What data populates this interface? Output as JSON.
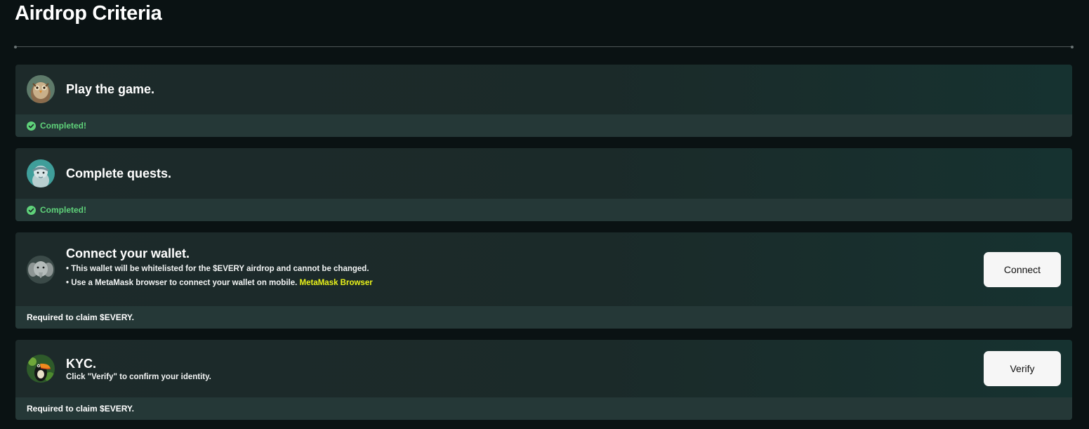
{
  "page": {
    "title": "Airdrop Criteria"
  },
  "colors": {
    "background": "#0a1213",
    "card": "#1d2a2a",
    "card_footer": "#253837",
    "completed_green": "#5fd27a",
    "link_yellow": "#e9f21a",
    "button_bg": "#f6f6f6"
  },
  "criteria": [
    {
      "avatar_icon": "owl-avatar-icon",
      "title": "Play the game.",
      "status": "Completed!",
      "status_icon": "check-circle-icon"
    },
    {
      "avatar_icon": "dolphin-avatar-icon",
      "title": "Complete quests.",
      "status": "Completed!",
      "status_icon": "check-circle-icon"
    },
    {
      "avatar_icon": "elephant-avatar-icon",
      "title": "Connect your wallet.",
      "desc_line1": "• This wallet will be whitelisted for the $EVERY airdrop and cannot be changed.",
      "desc_line2": "• Use a MetaMask browser to connect your wallet on mobile.",
      "desc_link": "MetaMask Browser",
      "button": "Connect",
      "footer": "Required to claim $EVERY."
    },
    {
      "avatar_icon": "toucan-avatar-icon",
      "title": "KYC.",
      "desc_line1": "Click \"Verify\" to confirm your identity.",
      "button": "Verify",
      "footer": "Required to claim $EVERY."
    }
  ]
}
